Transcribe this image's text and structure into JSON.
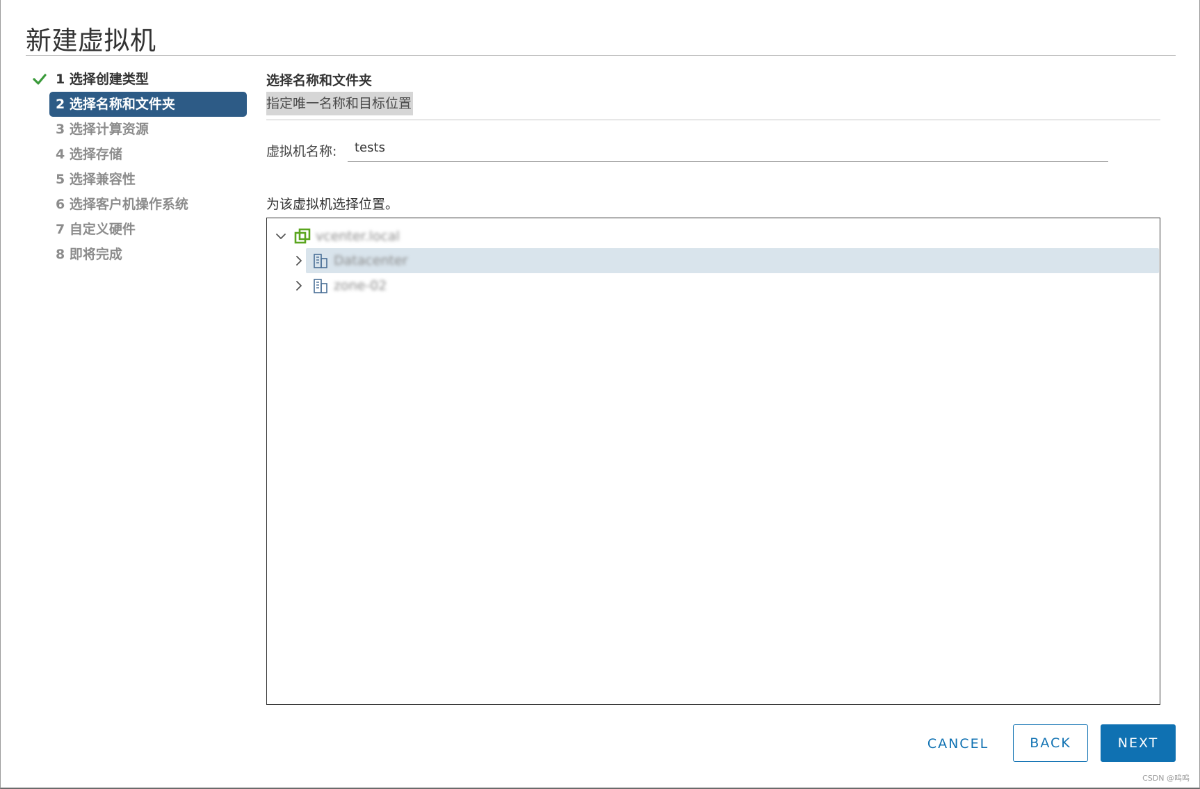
{
  "dialog": {
    "title": "新建虚拟机"
  },
  "steps": [
    {
      "label": "1 选择创建类型",
      "state": "done"
    },
    {
      "label": "2 选择名称和文件夹",
      "state": "active"
    },
    {
      "label": "3 选择计算资源",
      "state": "pending"
    },
    {
      "label": "4 选择存储",
      "state": "pending"
    },
    {
      "label": "5 选择兼容性",
      "state": "pending"
    },
    {
      "label": "6 选择客户机操作系统",
      "state": "pending"
    },
    {
      "label": "7 自定义硬件",
      "state": "pending"
    },
    {
      "label": "8 即将完成",
      "state": "pending"
    }
  ],
  "main": {
    "section_title": "选择名称和文件夹",
    "section_subtitle": "指定唯一名称和目标位置",
    "vm_name_label": "虚拟机名称:",
    "vm_name_value": "tests",
    "location_label": "为该虚拟机选择位置。",
    "tree": [
      {
        "label": "vcenter.local",
        "icon": "vcenter-icon",
        "expanded": true,
        "level": 0
      },
      {
        "label": "Datacenter",
        "icon": "datacenter-icon",
        "expanded": false,
        "level": 1,
        "selected": true
      },
      {
        "label": "zone-02",
        "icon": "datacenter-icon",
        "expanded": false,
        "level": 1,
        "selected": false
      }
    ]
  },
  "footer": {
    "cancel_label": "CANCEL",
    "back_label": "BACK",
    "next_label": "NEXT"
  },
  "watermark": "CSDN @呜呜",
  "colors": {
    "active_step_bg": "#2d5b86",
    "primary": "#0f71b2",
    "check_green": "#3a9a3a",
    "selected_row": "#d9e4ec"
  }
}
